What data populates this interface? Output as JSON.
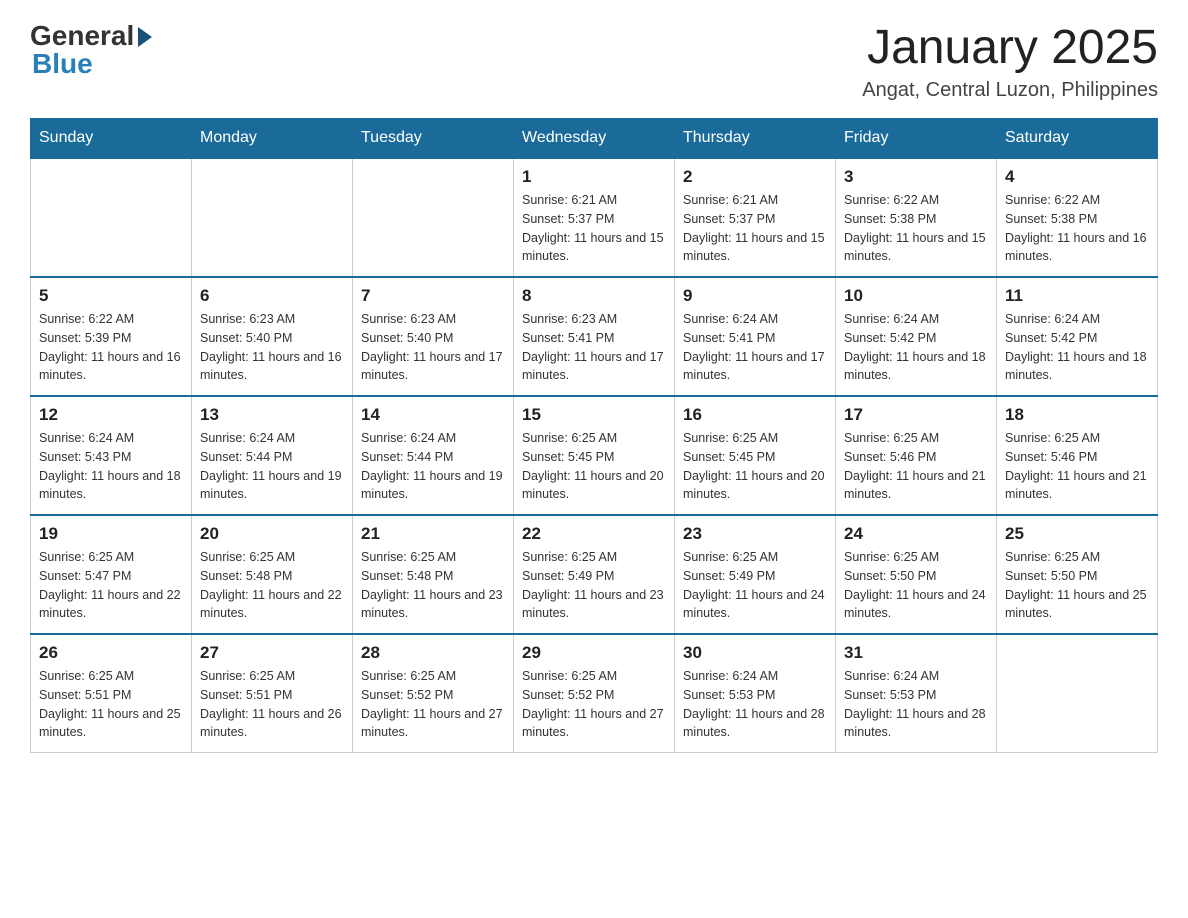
{
  "logo": {
    "general_text": "General",
    "blue_text": "Blue"
  },
  "header": {
    "title": "January 2025",
    "location": "Angat, Central Luzon, Philippines"
  },
  "weekdays": [
    "Sunday",
    "Monday",
    "Tuesday",
    "Wednesday",
    "Thursday",
    "Friday",
    "Saturday"
  ],
  "weeks": [
    [
      {
        "day": "",
        "sunrise": "",
        "sunset": "",
        "daylight": ""
      },
      {
        "day": "",
        "sunrise": "",
        "sunset": "",
        "daylight": ""
      },
      {
        "day": "",
        "sunrise": "",
        "sunset": "",
        "daylight": ""
      },
      {
        "day": "1",
        "sunrise": "Sunrise: 6:21 AM",
        "sunset": "Sunset: 5:37 PM",
        "daylight": "Daylight: 11 hours and 15 minutes."
      },
      {
        "day": "2",
        "sunrise": "Sunrise: 6:21 AM",
        "sunset": "Sunset: 5:37 PM",
        "daylight": "Daylight: 11 hours and 15 minutes."
      },
      {
        "day": "3",
        "sunrise": "Sunrise: 6:22 AM",
        "sunset": "Sunset: 5:38 PM",
        "daylight": "Daylight: 11 hours and 15 minutes."
      },
      {
        "day": "4",
        "sunrise": "Sunrise: 6:22 AM",
        "sunset": "Sunset: 5:38 PM",
        "daylight": "Daylight: 11 hours and 16 minutes."
      }
    ],
    [
      {
        "day": "5",
        "sunrise": "Sunrise: 6:22 AM",
        "sunset": "Sunset: 5:39 PM",
        "daylight": "Daylight: 11 hours and 16 minutes."
      },
      {
        "day": "6",
        "sunrise": "Sunrise: 6:23 AM",
        "sunset": "Sunset: 5:40 PM",
        "daylight": "Daylight: 11 hours and 16 minutes."
      },
      {
        "day": "7",
        "sunrise": "Sunrise: 6:23 AM",
        "sunset": "Sunset: 5:40 PM",
        "daylight": "Daylight: 11 hours and 17 minutes."
      },
      {
        "day": "8",
        "sunrise": "Sunrise: 6:23 AM",
        "sunset": "Sunset: 5:41 PM",
        "daylight": "Daylight: 11 hours and 17 minutes."
      },
      {
        "day": "9",
        "sunrise": "Sunrise: 6:24 AM",
        "sunset": "Sunset: 5:41 PM",
        "daylight": "Daylight: 11 hours and 17 minutes."
      },
      {
        "day": "10",
        "sunrise": "Sunrise: 6:24 AM",
        "sunset": "Sunset: 5:42 PM",
        "daylight": "Daylight: 11 hours and 18 minutes."
      },
      {
        "day": "11",
        "sunrise": "Sunrise: 6:24 AM",
        "sunset": "Sunset: 5:42 PM",
        "daylight": "Daylight: 11 hours and 18 minutes."
      }
    ],
    [
      {
        "day": "12",
        "sunrise": "Sunrise: 6:24 AM",
        "sunset": "Sunset: 5:43 PM",
        "daylight": "Daylight: 11 hours and 18 minutes."
      },
      {
        "day": "13",
        "sunrise": "Sunrise: 6:24 AM",
        "sunset": "Sunset: 5:44 PM",
        "daylight": "Daylight: 11 hours and 19 minutes."
      },
      {
        "day": "14",
        "sunrise": "Sunrise: 6:24 AM",
        "sunset": "Sunset: 5:44 PM",
        "daylight": "Daylight: 11 hours and 19 minutes."
      },
      {
        "day": "15",
        "sunrise": "Sunrise: 6:25 AM",
        "sunset": "Sunset: 5:45 PM",
        "daylight": "Daylight: 11 hours and 20 minutes."
      },
      {
        "day": "16",
        "sunrise": "Sunrise: 6:25 AM",
        "sunset": "Sunset: 5:45 PM",
        "daylight": "Daylight: 11 hours and 20 minutes."
      },
      {
        "day": "17",
        "sunrise": "Sunrise: 6:25 AM",
        "sunset": "Sunset: 5:46 PM",
        "daylight": "Daylight: 11 hours and 21 minutes."
      },
      {
        "day": "18",
        "sunrise": "Sunrise: 6:25 AM",
        "sunset": "Sunset: 5:46 PM",
        "daylight": "Daylight: 11 hours and 21 minutes."
      }
    ],
    [
      {
        "day": "19",
        "sunrise": "Sunrise: 6:25 AM",
        "sunset": "Sunset: 5:47 PM",
        "daylight": "Daylight: 11 hours and 22 minutes."
      },
      {
        "day": "20",
        "sunrise": "Sunrise: 6:25 AM",
        "sunset": "Sunset: 5:48 PM",
        "daylight": "Daylight: 11 hours and 22 minutes."
      },
      {
        "day": "21",
        "sunrise": "Sunrise: 6:25 AM",
        "sunset": "Sunset: 5:48 PM",
        "daylight": "Daylight: 11 hours and 23 minutes."
      },
      {
        "day": "22",
        "sunrise": "Sunrise: 6:25 AM",
        "sunset": "Sunset: 5:49 PM",
        "daylight": "Daylight: 11 hours and 23 minutes."
      },
      {
        "day": "23",
        "sunrise": "Sunrise: 6:25 AM",
        "sunset": "Sunset: 5:49 PM",
        "daylight": "Daylight: 11 hours and 24 minutes."
      },
      {
        "day": "24",
        "sunrise": "Sunrise: 6:25 AM",
        "sunset": "Sunset: 5:50 PM",
        "daylight": "Daylight: 11 hours and 24 minutes."
      },
      {
        "day": "25",
        "sunrise": "Sunrise: 6:25 AM",
        "sunset": "Sunset: 5:50 PM",
        "daylight": "Daylight: 11 hours and 25 minutes."
      }
    ],
    [
      {
        "day": "26",
        "sunrise": "Sunrise: 6:25 AM",
        "sunset": "Sunset: 5:51 PM",
        "daylight": "Daylight: 11 hours and 25 minutes."
      },
      {
        "day": "27",
        "sunrise": "Sunrise: 6:25 AM",
        "sunset": "Sunset: 5:51 PM",
        "daylight": "Daylight: 11 hours and 26 minutes."
      },
      {
        "day": "28",
        "sunrise": "Sunrise: 6:25 AM",
        "sunset": "Sunset: 5:52 PM",
        "daylight": "Daylight: 11 hours and 27 minutes."
      },
      {
        "day": "29",
        "sunrise": "Sunrise: 6:25 AM",
        "sunset": "Sunset: 5:52 PM",
        "daylight": "Daylight: 11 hours and 27 minutes."
      },
      {
        "day": "30",
        "sunrise": "Sunrise: 6:24 AM",
        "sunset": "Sunset: 5:53 PM",
        "daylight": "Daylight: 11 hours and 28 minutes."
      },
      {
        "day": "31",
        "sunrise": "Sunrise: 6:24 AM",
        "sunset": "Sunset: 5:53 PM",
        "daylight": "Daylight: 11 hours and 28 minutes."
      },
      {
        "day": "",
        "sunrise": "",
        "sunset": "",
        "daylight": ""
      }
    ]
  ]
}
